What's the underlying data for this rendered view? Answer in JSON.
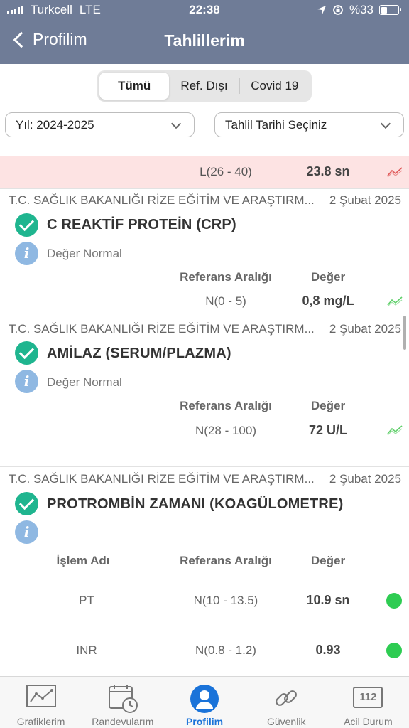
{
  "status_bar": {
    "carrier": "Turkcell",
    "network": "LTE",
    "time": "22:38",
    "battery": "%33",
    "battery_level": 0.33
  },
  "nav": {
    "back_label": "Profilim",
    "title": "Tahlillerim"
  },
  "segments": [
    {
      "label": "Tümü",
      "active": true
    },
    {
      "label": "Ref. Dışı",
      "active": false
    },
    {
      "label": "Covid 19",
      "active": false
    }
  ],
  "filters": {
    "year": "Yıl: 2024-2025",
    "date_placeholder": "Tahlil Tarihi Seçiniz"
  },
  "highlight_row": {
    "reference": "L(26 - 40)",
    "value": "23.8 sn"
  },
  "cards": [
    {
      "hospital": "T.C. SAĞLIK BAKANLIĞI RİZE EĞİTİM VE ARAŞTIRM...",
      "date": "2 Şubat 2025",
      "title": "C REAKTİF PROTEİN (CRP)",
      "status": "Değer Normal",
      "headers": {
        "ref": "Referans Aralığı",
        "value": "Değer"
      },
      "reference": "N(0 - 5)",
      "value": "0,8 mg/L"
    },
    {
      "hospital": "T.C. SAĞLIK BAKANLIĞI RİZE EĞİTİM VE ARAŞTIRM...",
      "date": "2 Şubat 2025",
      "title": "AMİLAZ (SERUM/PLAZMA)",
      "status": "Değer Normal",
      "headers": {
        "ref": "Referans Aralığı",
        "value": "Değer"
      },
      "reference": "N(28 - 100)",
      "value": "72 U/L"
    },
    {
      "hospital": "T.C. SAĞLIK BAKANLIĞI RİZE EĞİTİM VE ARAŞTIRM...",
      "date": "2 Şubat 2025",
      "title": "PROTROMBİN ZAMANI (KOAGÜLOMETRE)",
      "headers": {
        "name": "İşlem Adı",
        "ref": "Referans Aralığı",
        "value": "Değer"
      },
      "rows": [
        {
          "name": "PT",
          "reference": "N(10 - 13.5)",
          "value": "10.9 sn"
        },
        {
          "name": "INR",
          "reference": "N(0.8 - 1.2)",
          "value": "0.93"
        }
      ]
    }
  ],
  "tabs": [
    {
      "label": "Grafiklerim",
      "icon": "chart-icon"
    },
    {
      "label": "Randevularım",
      "icon": "calendar-clock-icon"
    },
    {
      "label": "Profilim",
      "icon": "user-icon",
      "active": true
    },
    {
      "label": "Güvenlik",
      "icon": "chain-link-icon"
    },
    {
      "label": "Acil Durum",
      "icon": "emergency-112-icon",
      "icon_text": "112"
    }
  ],
  "colors": {
    "header": "#6f7c97",
    "check": "#1fb58f",
    "info": "#8fb8e2",
    "highlight": "#fde3e3",
    "dot_normal": "#2ecc52",
    "tab_active": "#1a73d9",
    "trend_red": "#e05a5a",
    "trend_green": "#5fcf6a"
  }
}
